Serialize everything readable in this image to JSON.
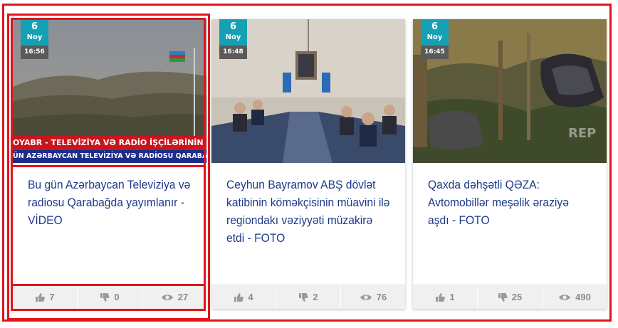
{
  "colors": {
    "accent_red": "#e0141b",
    "title_blue": "#1d3a8a",
    "badge_teal": "#16a0b3"
  },
  "cards": [
    {
      "day": "6",
      "month": "Noy",
      "time": "16:56",
      "ticker_top": "OYABR - TELEVİZİYA VƏ RADİO İŞÇİLƏRİNİN PEŞƏ B",
      "ticker_bottom": "ÜN AZƏRBAYCAN TELEVİZİYA VƏ RADİOSU QARABAĞDA YAYIMLANI",
      "title": "Bu gün Azərbaycan Televiziya və radiosu Qarabağda yayımlanır - VİDEO",
      "likes": "7",
      "dislikes": "0",
      "views": "27"
    },
    {
      "day": "6",
      "month": "Noy",
      "time": "16:48",
      "title": "Ceyhun Bayramov ABŞ dövlət katibinin köməkçisinin müavini ilə regiondakı vəziyyəti müzakirə etdi - FOTO",
      "likes": "4",
      "dislikes": "2",
      "views": "76"
    },
    {
      "day": "6",
      "month": "Noy",
      "time": "16:45",
      "watermark": "REP",
      "title": "Qaxda dəhşətli QƏZA: Avtomobillər meşəlik əraziyə aşdı - FOTO",
      "likes": "1",
      "dislikes": "25",
      "views": "490"
    }
  ]
}
